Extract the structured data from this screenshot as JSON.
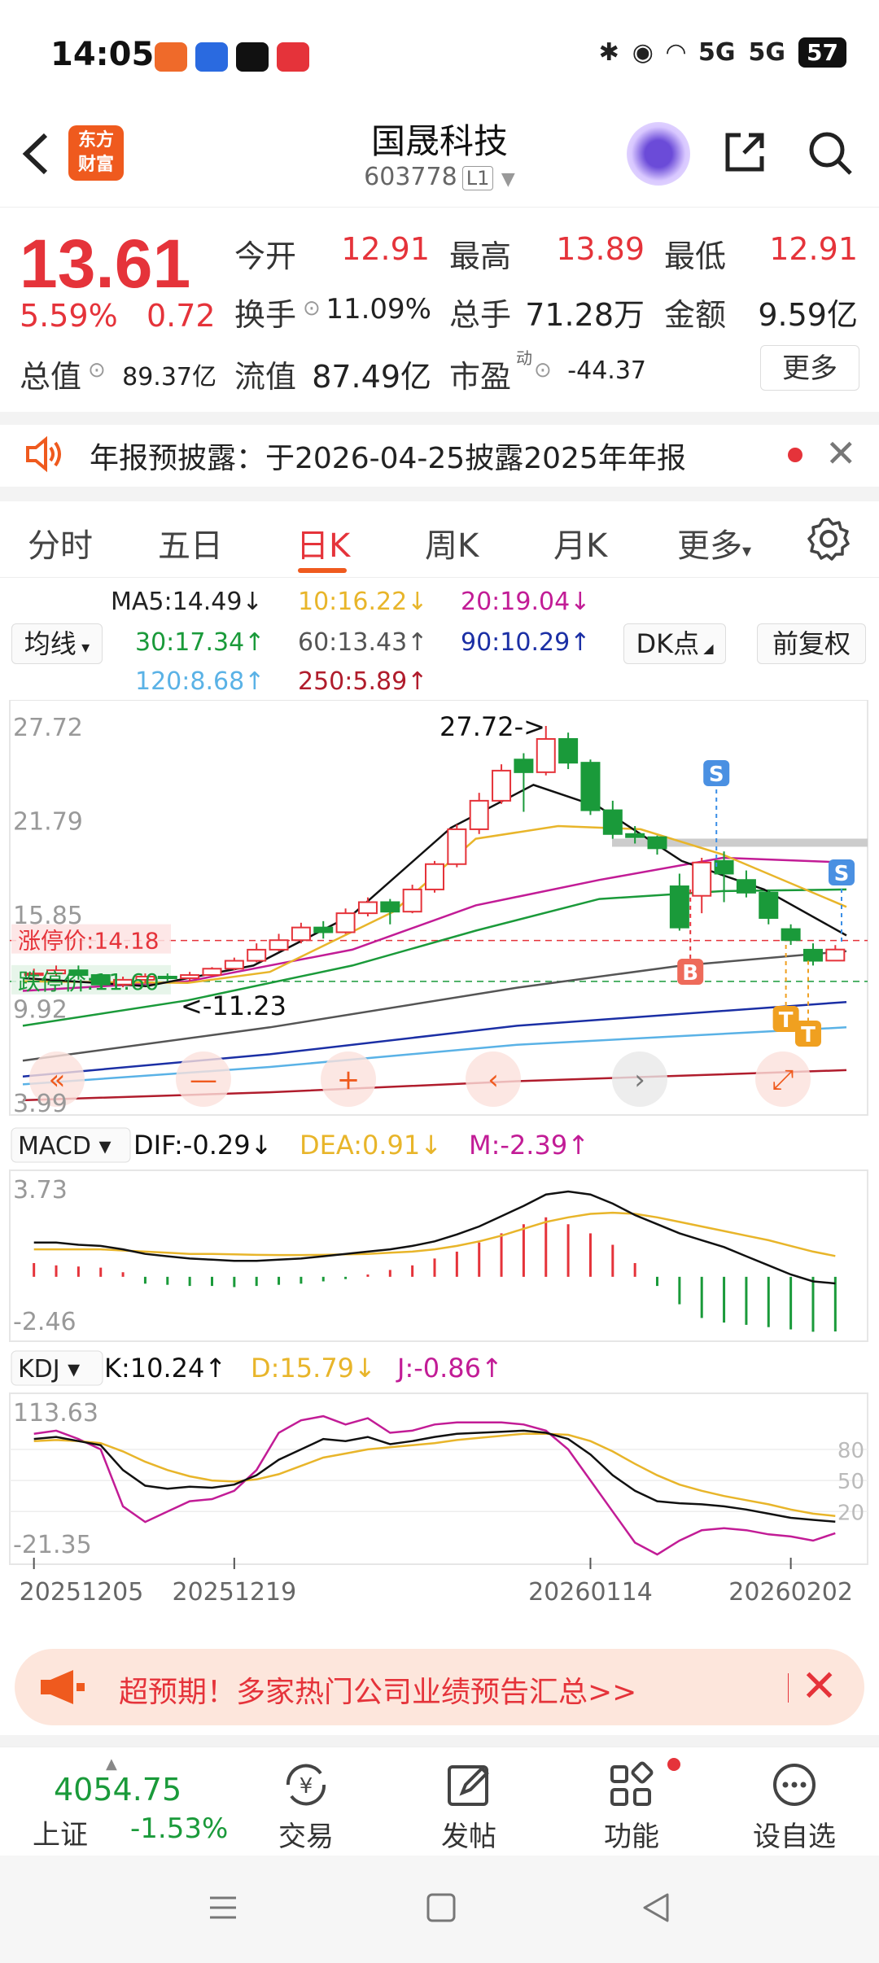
{
  "status": {
    "time": "14:05",
    "net_5g_a": "5G",
    "net_5g_b": "5G",
    "battery": "57"
  },
  "header": {
    "logo_text_top": "东方",
    "logo_text_bottom": "财富",
    "stock_name": "国晟科技",
    "stock_code": "603778",
    "level_badge": "L1"
  },
  "quote": {
    "price": "13.61",
    "change_pct": "5.59%",
    "change_amt": "0.72",
    "open_label": "今开",
    "open": "12.91",
    "high_label": "最高",
    "high": "13.89",
    "low_label": "最低",
    "low": "12.91",
    "turnover_label": "换手",
    "turnover": "11.09%",
    "volume_label": "总手",
    "volume": "71.28万",
    "amount_label": "金额",
    "amount": "9.59亿",
    "mktcap_label": "总值",
    "mktcap": "89.37亿",
    "float_label": "流值",
    "float": "87.49亿",
    "pe_label": "市盈",
    "pe_sup": "动",
    "pe": "-44.37",
    "more_label": "更多"
  },
  "notice": {
    "text": "年报预披露：于2026-04-25披露2025年年报"
  },
  "tabs": [
    {
      "label": "分时"
    },
    {
      "label": "五日"
    },
    {
      "label": "日K"
    },
    {
      "label": "周K"
    },
    {
      "label": "月K"
    },
    {
      "label": "更多"
    }
  ],
  "ma": {
    "selector": "均线",
    "ma5": "MA5:14.49↓",
    "ma10": "10:16.22↓",
    "ma20": "20:19.04↓",
    "ma30": "30:17.34↑",
    "ma60": "60:13.43↑",
    "ma90": "90:10.29↑",
    "ma120": "120:8.68↑",
    "ma250": "250:5.89↑",
    "dk_button": "DK点",
    "adjust_button": "前复权"
  },
  "kline": {
    "y_labels": [
      "27.72",
      "21.79",
      "15.85",
      "9.92",
      "3.99"
    ],
    "max_marker": "27.72->",
    "min_marker": "<-11.23",
    "limit_up": "涨停价:14.18",
    "limit_down": "跌停价:11.60",
    "marker_s": "S",
    "marker_b": "B",
    "marker_t": "T"
  },
  "macd": {
    "selector": "MACD",
    "dif": "DIF:-0.29↓",
    "dea": "DEA:0.91↓",
    "m": "M:-2.39↑",
    "y_top": "3.73",
    "y_bottom": "-2.46"
  },
  "kdj": {
    "selector": "KDJ",
    "k": "K:10.24↑",
    "d": "D:15.79↓",
    "j": "J:-0.86↑",
    "y_top": "113.63",
    "y_bottom": "-21.35",
    "levels": [
      "80",
      "50",
      "20"
    ]
  },
  "dates": [
    "20251205",
    "20251219",
    "20260114",
    "20260202"
  ],
  "banner": {
    "text": "超预期！多家热门公司业绩预告汇总>>"
  },
  "bottom_nav": {
    "index_value": "4054.75",
    "index_name": "上证",
    "index_pct": "-1.53%",
    "items": [
      {
        "label": "交易"
      },
      {
        "label": "发帖"
      },
      {
        "label": "功能"
      },
      {
        "label": "设自选"
      }
    ]
  },
  "colors": {
    "up": "#e5333a",
    "down": "#1a9a3a",
    "accent": "#ef5a1e",
    "ma5": "#111111",
    "ma10": "#e8b52a",
    "ma20": "#c21c96",
    "ma30": "#1a9a3a",
    "ma60": "#555555",
    "ma90": "#1b2fa5",
    "ma120": "#5ab2e6",
    "ma250": "#b01c2c"
  }
}
